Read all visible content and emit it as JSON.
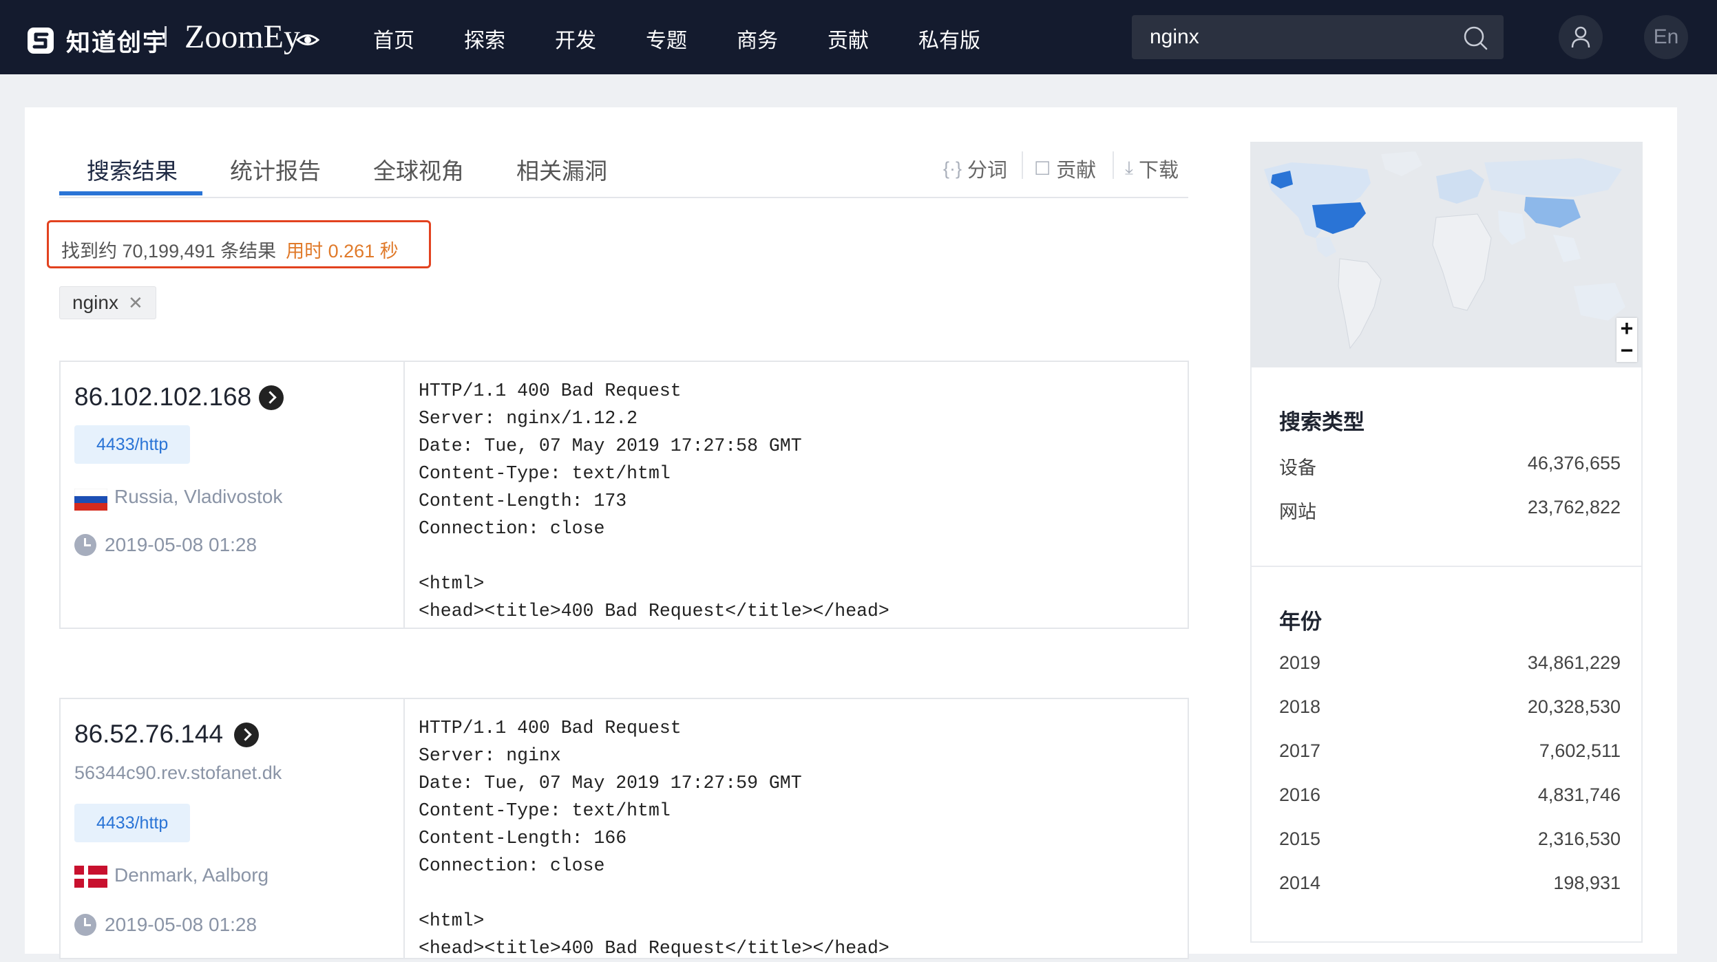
{
  "header": {
    "brand_cn": "知道创宇",
    "brand_en": "ZoomEy",
    "nav": [
      "首页",
      "探索",
      "开发",
      "专题",
      "商务",
      "贡献",
      "私有版"
    ],
    "search_value": "nginx",
    "lang": "En"
  },
  "tabs": [
    "搜索结果",
    "统计报告",
    "全球视角",
    "相关漏洞"
  ],
  "tools": {
    "segment": "分词",
    "contribute": "贡献",
    "download": "下载"
  },
  "summary": {
    "count_text": "找到约 70,199,491 条结果",
    "time_text": "用时 0.261 秒"
  },
  "query_chip": "nginx",
  "results": [
    {
      "ip": "86.102.102.168",
      "hostname": "",
      "port": "4433/http",
      "location": "Russia, Vladivostok",
      "time": "2019-05-08 01:28",
      "banner": "HTTP/1.1 400 Bad Request\nServer: nginx/1.12.2\nDate: Tue, 07 May 2019 17:27:58 GMT\nContent-Type: text/html\nContent-Length: 173\nConnection: close\n\n<html>\n<head><title>400 Bad Request</title></head>"
    },
    {
      "ip": "86.52.76.144",
      "hostname": "56344c90.rev.stofanet.dk",
      "port": "4433/http",
      "location": "Denmark, Aalborg",
      "time": "2019-05-08 01:28",
      "banner": "HTTP/1.1 400 Bad Request\nServer: nginx\nDate: Tue, 07 May 2019 17:27:59 GMT\nContent-Type: text/html\nContent-Length: 166\nConnection: close\n\n<html>\n<head><title>400 Bad Request</title></head>"
    }
  ],
  "map": {
    "zoom_in": "+",
    "zoom_out": "−"
  },
  "search_type": {
    "title": "搜索类型",
    "rows": [
      {
        "label": "设备",
        "value": "46,376,655"
      },
      {
        "label": "网站",
        "value": "23,762,822"
      }
    ]
  },
  "years": {
    "title": "年份",
    "rows": [
      {
        "label": "2019",
        "value": "34,861,229"
      },
      {
        "label": "2018",
        "value": "20,328,530"
      },
      {
        "label": "2017",
        "value": "7,602,511"
      },
      {
        "label": "2016",
        "value": "4,831,746"
      },
      {
        "label": "2015",
        "value": "2,316,530"
      },
      {
        "label": "2014",
        "value": "198,931"
      }
    ]
  },
  "colors": {
    "accent": "#2a74d6",
    "header_bg": "#141b2e",
    "highlight_border": "#e2421f",
    "time_orange": "#e07a2a"
  }
}
